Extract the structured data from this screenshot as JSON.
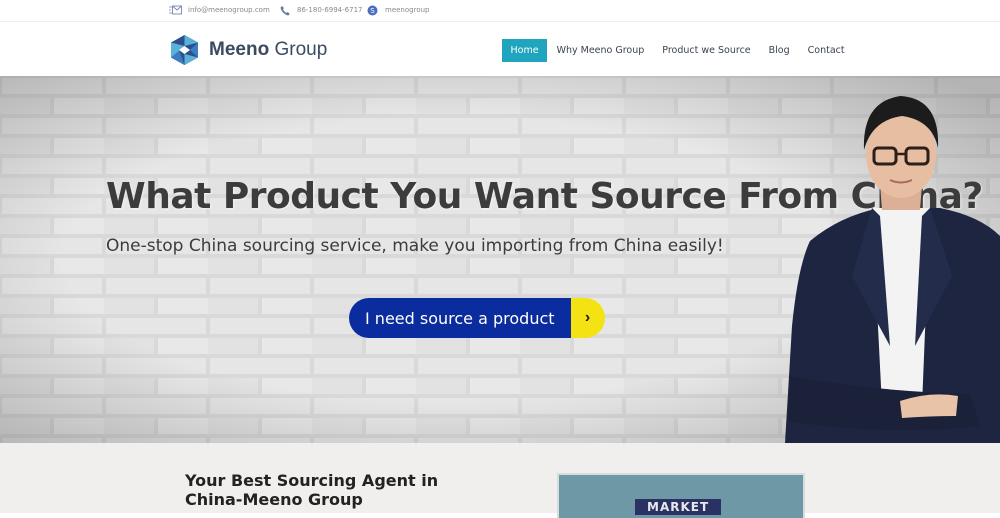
{
  "topbar": {
    "email": "info@meenogroup.com",
    "phone": "86-180-6994-6717",
    "skype": "meenogroup",
    "email_icon": "email-icon",
    "phone_icon": "phone-icon",
    "skype_icon": "skype-icon"
  },
  "header": {
    "logo_bold": "Meeno",
    "logo_rest": " Group",
    "nav": [
      {
        "label": "Home",
        "active": true
      },
      {
        "label": "Why Meeno Group"
      },
      {
        "label": "Product we Source"
      },
      {
        "label": "Blog"
      },
      {
        "label": "Contact"
      }
    ]
  },
  "hero": {
    "title": "What Product You Want Source From China?",
    "subtitle": "One-stop China sourcing service, make you importing from China easily!",
    "cta_label": "I need source a product",
    "cta_icon": "chevron-right-icon"
  },
  "lower": {
    "heading": "Your Best Sourcing Agent in China-Meeno Group",
    "image_label": "MARKET"
  },
  "colors": {
    "nav_active": "#1fa5bd",
    "cta_primary": "#0b2c9e",
    "cta_accent": "#f5e212",
    "logo_text": "#3a4b60"
  }
}
